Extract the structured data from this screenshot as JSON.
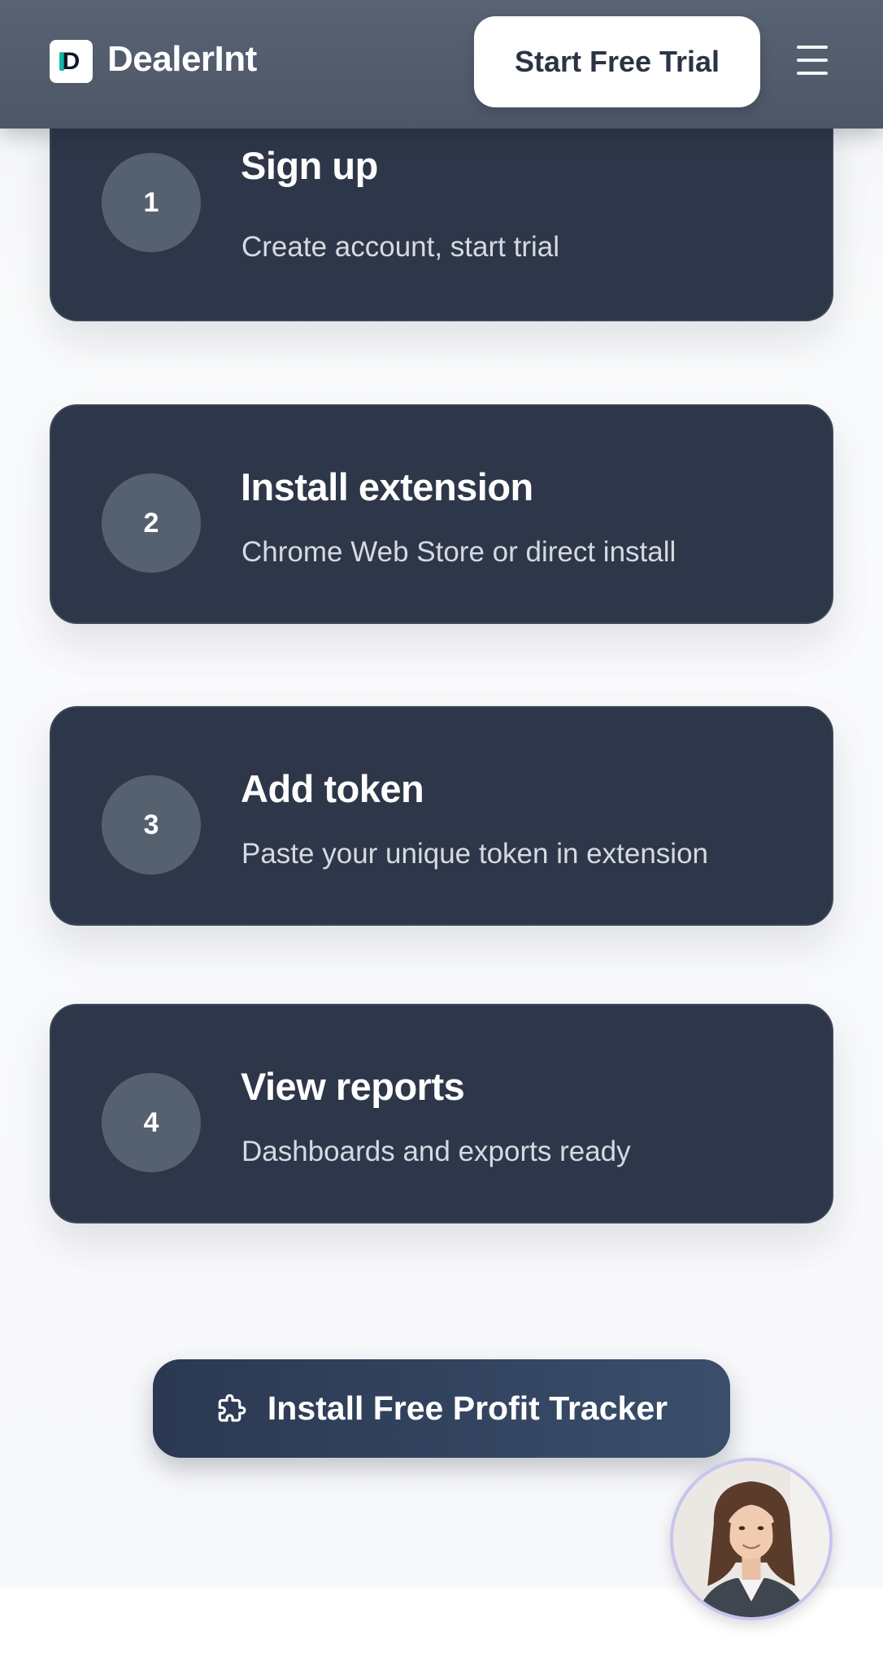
{
  "header": {
    "logo_letter": "D",
    "brand": "DealerInt",
    "trial_button": "Start Free Trial",
    "menu_icon": "hamburger-menu-icon"
  },
  "steps": [
    {
      "number": "1",
      "title": "Sign up",
      "description": "Create account, start trial"
    },
    {
      "number": "2",
      "title": "Install extension",
      "description": "Chrome Web Store or direct install"
    },
    {
      "number": "3",
      "title": "Add token",
      "description": "Paste your unique token in extension"
    },
    {
      "number": "4",
      "title": "View reports",
      "description": "Dashboards and exports ready"
    }
  ],
  "cta": {
    "label": "Install Free Profit Tracker",
    "icon": "puzzle-piece-icon"
  },
  "chat_avatar": {
    "icon": "support-agent-avatar"
  },
  "colors": {
    "header_bg": "#586373",
    "card_bg": "#2e3749",
    "number_circle": "#566170",
    "cta_bg_start": "#2b3852",
    "cta_bg_end": "#3a4e6b",
    "logo_accent": "#14b8a6",
    "avatar_ring": "#c9c3ef"
  }
}
